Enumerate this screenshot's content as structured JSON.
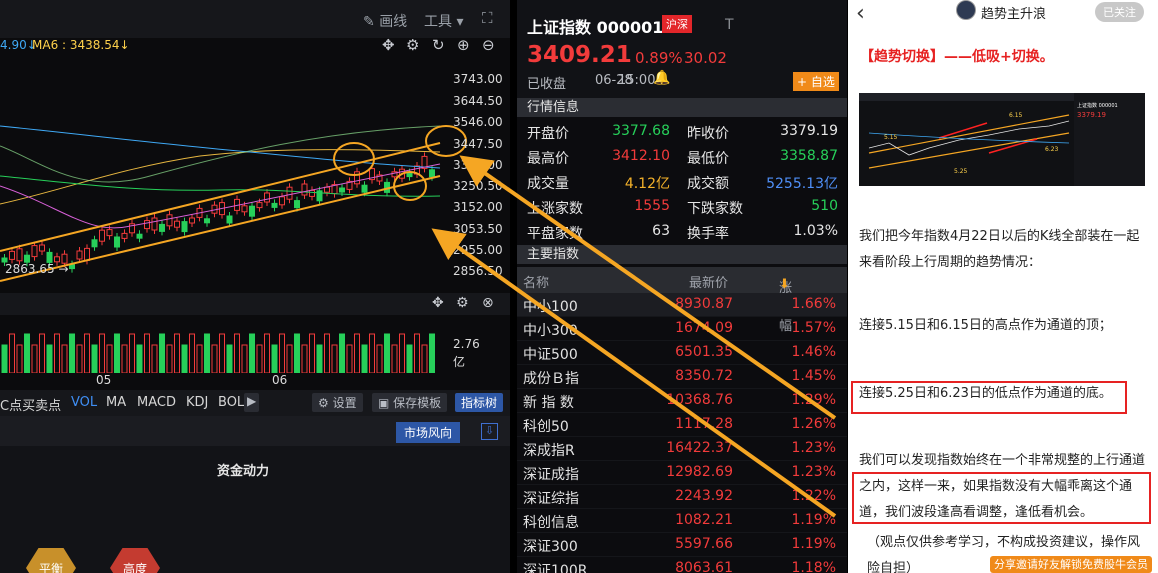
{
  "chart_toolbar": {
    "draw_label": "画线",
    "tools_label": "工具"
  },
  "ma_bar": {
    "ma_left": "4.90↓",
    "ma6": "MA6 : 3438.54↓"
  },
  "price_axis": [
    "3743.00",
    "3644.50",
    "3546.00",
    "3447.50",
    "3349.00",
    "3250.50",
    "3152.00",
    "3053.50",
    "2955.00",
    "2856.50"
  ],
  "low_marker": "2863.65",
  "volume_axis": {
    "value": "2.76",
    "unit": "亿"
  },
  "date_labels": [
    "05",
    "06"
  ],
  "indicator_bar": {
    "items": [
      "C点买卖点",
      "VOL",
      "MA",
      "MACD",
      "KDJ",
      "BOL"
    ],
    "settings": "设置",
    "save_template": "保存模板",
    "indicator_tree": "指标树"
  },
  "bottom_panel": {
    "market_wind": "市场风向",
    "fund_power": "资金动力",
    "hex_left": "平衡",
    "hex_right": "高度"
  },
  "quote": {
    "name": "上证指数 000001",
    "tag": "沪深",
    "t_mark": "T",
    "price": "3409.21",
    "change_pct": "0.89%",
    "change": "30.02",
    "status": "已收盘",
    "date": "06-28",
    "time": "15:00",
    "add_watch": "+ 自选"
  },
  "market_info": {
    "header": "行情信息",
    "rows": [
      [
        {
          "label": "开盘价",
          "value": "3377.68",
          "color": "#27d05a"
        },
        {
          "label": "昨收价",
          "value": "3379.19",
          "color": "#e6e6e6"
        }
      ],
      [
        {
          "label": "最高价",
          "value": "3412.10",
          "color": "#f23b3b"
        },
        {
          "label": "最低价",
          "value": "3358.87",
          "color": "#27d05a"
        }
      ],
      [
        {
          "label": "成交量",
          "value": "4.12亿",
          "color": "#f5b22a"
        },
        {
          "label": "成交额",
          "value": "5255.13亿",
          "color": "#4f8ff7"
        }
      ],
      [
        {
          "label": "上涨家数",
          "value": "1555",
          "color": "#f23b3b"
        },
        {
          "label": "下跌家数",
          "value": "510",
          "color": "#27d05a"
        }
      ],
      [
        {
          "label": "平盘家数",
          "value": "63",
          "color": "#e6e6e6"
        },
        {
          "label": "换手率",
          "value": "1.03%",
          "color": "#e6e6e6"
        }
      ]
    ]
  },
  "main_index": {
    "header": "主要指数",
    "col_name": "名称",
    "col_price": "最新价",
    "col_change": "涨跌幅",
    "rows": [
      {
        "name": "中小100",
        "price": "8930.87",
        "change": "1.66%"
      },
      {
        "name": "中小300",
        "price": "1674.09",
        "change": "1.57%"
      },
      {
        "name": "中证500",
        "price": "6501.35",
        "change": "1.46%"
      },
      {
        "name": "成份Ｂ指",
        "price": "8350.72",
        "change": "1.45%"
      },
      {
        "name": "新 指 数",
        "price": "10368.76",
        "change": "1.29%"
      },
      {
        "name": "科创50",
        "price": "1117.28",
        "change": "1.26%"
      },
      {
        "name": "深成指R",
        "price": "16422.37",
        "change": "1.23%"
      },
      {
        "name": "深证成指",
        "price": "12982.69",
        "change": "1.23%"
      },
      {
        "name": "深证综指",
        "price": "2243.92",
        "change": "1.22%"
      },
      {
        "name": "科创信息",
        "price": "1082.21",
        "change": "1.19%"
      },
      {
        "name": "深证300",
        "price": "5597.66",
        "change": "1.19%"
      },
      {
        "name": "深证100R",
        "price": "8063.61",
        "change": "1.18%"
      }
    ]
  },
  "article": {
    "author": "趋势主升浪",
    "follow_label": "已关注",
    "title": "【趋势切换】——低吸+切换。",
    "p1": "我们把今年指数4月22日以后的K线全部装在一起来看阶段上行周期的趋势情况：",
    "p2": "连接5.15日和6.15日的高点作为通道的顶；",
    "p3": "连接5.25日和6.23日的低点作为通道的底。",
    "p4": "我们可以发现指数始终在一个非常规整的上行通道之内，这样一来，如果指数没有大幅乖离这个通道，我们波段逢高看调整，逢低看机会。",
    "p5": "（观点仅供参考学习，不构成投资建议，操作风险自担）",
    "share": "分享邀请好友解锁免费股牛会员",
    "thumb": {
      "label_a": "6.15",
      "label_b": "5.15",
      "label_c": "6.23",
      "label_d": "5.25",
      "label_e": "上证指数 000001",
      "label_f": "3379.19"
    }
  }
}
